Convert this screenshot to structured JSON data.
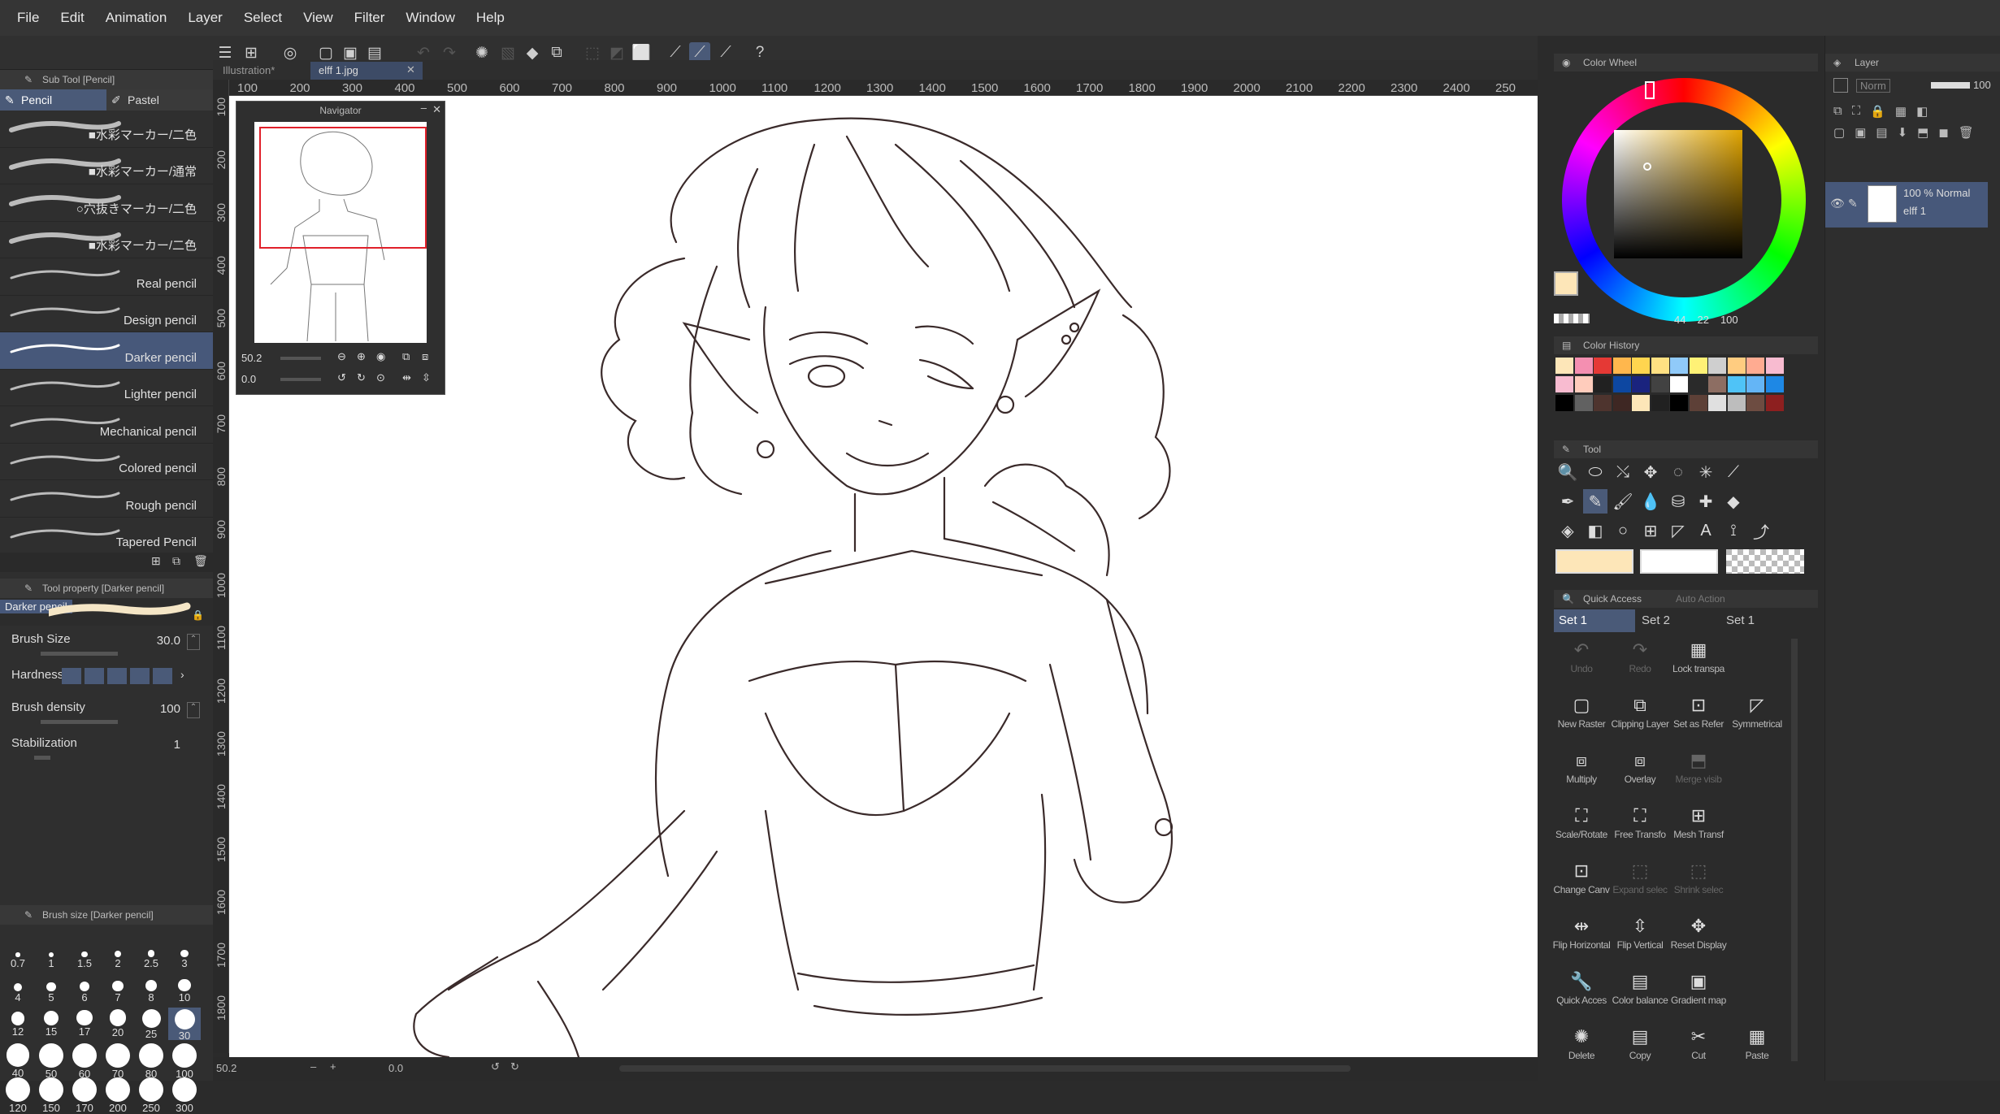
{
  "app": {
    "title_hint": ""
  },
  "menu": [
    "File",
    "Edit",
    "Animation",
    "Layer",
    "Select",
    "View",
    "Filter",
    "Window",
    "Help"
  ],
  "doc_tabs": [
    {
      "label": "Illustration*"
    },
    {
      "label": "elff 1.jpg"
    }
  ],
  "sub_tool": {
    "header": "Sub Tool [Pencil]",
    "tabs": [
      {
        "label": "Pencil",
        "icon": "pencil-icon"
      },
      {
        "label": "Pastel",
        "icon": "pastel-icon"
      }
    ],
    "brushes": [
      {
        "label": "■水彩マーカー/二色"
      },
      {
        "label": "■水彩マーカー/通常"
      },
      {
        "label": "○穴抜きマーカー/二色"
      },
      {
        "label": "■水彩マーカー/二色"
      },
      {
        "label": "Real pencil"
      },
      {
        "label": "Design pencil"
      },
      {
        "label": "Darker pencil",
        "selected": true
      },
      {
        "label": "Lighter pencil"
      },
      {
        "label": "Mechanical pencil"
      },
      {
        "label": "Colored pencil"
      },
      {
        "label": "Rough pencil"
      },
      {
        "label": "Tapered Pencil"
      }
    ]
  },
  "tool_property": {
    "header": "Tool property [Darker pencil]",
    "preview_label": "Darker pencil",
    "brush_size": {
      "label": "Brush Size",
      "value": "30.0"
    },
    "hardness": {
      "label": "Hardness"
    },
    "brush_density": {
      "label": "Brush density",
      "value": "100"
    },
    "stabilization": {
      "label": "Stabilization",
      "value": "1"
    }
  },
  "brush_size_panel": {
    "header": "Brush size [Darker pencil]",
    "sizes": [
      "0.7",
      "1",
      "1.5",
      "2",
      "2.5",
      "3",
      "4",
      "5",
      "6",
      "7",
      "8",
      "10",
      "12",
      "15",
      "17",
      "20",
      "25",
      "30",
      "40",
      "50",
      "60",
      "70",
      "80",
      "100",
      "120",
      "150",
      "170",
      "200",
      "250",
      "300"
    ],
    "selected": "30"
  },
  "ruler": {
    "h_ticks": [
      "100",
      "200",
      "300",
      "400",
      "500",
      "600",
      "700",
      "800",
      "900",
      "1000",
      "1100",
      "1200",
      "1300",
      "1400",
      "1500",
      "1600",
      "1700",
      "1800",
      "1900",
      "2000",
      "2100",
      "2200",
      "2300",
      "2400",
      "250"
    ],
    "v_ticks": [
      "100",
      "200",
      "300",
      "400",
      "500",
      "600",
      "700",
      "800",
      "900",
      "1000",
      "1100",
      "1200",
      "1300",
      "1400",
      "1500",
      "1600",
      "1700",
      "1800"
    ]
  },
  "navigator": {
    "title": "Navigator",
    "zoom": "50.2",
    "rotation": "0.0"
  },
  "status": {
    "zoom": "50.2",
    "rotation": "0.0"
  },
  "color_wheel": {
    "header": "Color Wheel",
    "readout": [
      "44",
      "22",
      "100"
    ],
    "main_color": "#fde6b8",
    "sub_color": "#ffffff"
  },
  "color_history": {
    "header": "Color History",
    "rows": [
      [
        "#fde6b8",
        "#f48fb1",
        "#e53935",
        "#ffb74d",
        "#ffd54f",
        "#ffe082",
        "#90caf9",
        "#fff176",
        "#cfcfcf",
        "#ffcc80",
        "#ffab91",
        "#f8bbd0"
      ],
      [
        "#f8bbd0",
        "#ffccbc",
        "#212121",
        "#0d47a1",
        "#1a237e",
        "#424242",
        "#ffffff",
        "#2a2a2a",
        "#8d6e63",
        "#4fc3f7",
        "#64b5f6",
        "#1e88e5"
      ],
      [
        "#000000",
        "#616161",
        "#4e342e",
        "#3e2723",
        "#fde6b8",
        "#212121",
        "#000000",
        "#5d4037",
        "#e0e0e0",
        "#bdbdbd",
        "#6d4c41",
        "#8d1f1f"
      ]
    ]
  },
  "tool_panel": {
    "header": "Tool"
  },
  "quick_access": {
    "header": "Quick Access",
    "header2": "Auto Action",
    "sets": [
      "Set 1",
      "Set 2",
      "Set 1"
    ],
    "buttons": [
      {
        "label": "Undo",
        "icon": "undo-icon",
        "dim": true
      },
      {
        "label": "Redo",
        "icon": "redo-icon",
        "dim": true
      },
      {
        "label": "Lock transpa",
        "icon": "lock-transparency-icon"
      },
      {
        "label": "New Raster",
        "icon": "new-raster-icon"
      },
      {
        "label": "Clipping Layer",
        "icon": "clipping-layer-icon"
      },
      {
        "label": "Set as Refer",
        "icon": "reference-icon"
      },
      {
        "label": "Symmetrical",
        "icon": "symmetrical-ruler-icon"
      },
      {
        "label": "Multiply",
        "icon": "multiply-icon"
      },
      {
        "label": "Overlay",
        "icon": "overlay-icon"
      },
      {
        "label": "Merge visib",
        "icon": "merge-visible-icon",
        "dim": true
      },
      {
        "label": "Scale/Rotate",
        "icon": "scale-rotate-icon"
      },
      {
        "label": "Free Transfo",
        "icon": "free-transform-icon"
      },
      {
        "label": "Mesh Transf",
        "icon": "mesh-transform-icon"
      },
      {
        "label": "Change Canv",
        "icon": "change-canvas-icon"
      },
      {
        "label": "Expand selec",
        "icon": "expand-selection-icon",
        "dim": true
      },
      {
        "label": "Shrink selec",
        "icon": "shrink-selection-icon",
        "dim": true
      },
      {
        "label": "Flip Horizontal",
        "icon": "flip-horizontal-icon"
      },
      {
        "label": "Flip Vertical",
        "icon": "flip-vertical-icon"
      },
      {
        "label": "Reset Display",
        "icon": "reset-display-icon"
      },
      {
        "label": "Quick Acces",
        "icon": "quick-access-icon"
      },
      {
        "label": "Color balance",
        "icon": "color-balance-icon"
      },
      {
        "label": "Gradient map",
        "icon": "gradient-map-icon"
      },
      {
        "label": "Delete",
        "icon": "delete-icon"
      },
      {
        "label": "Copy",
        "icon": "copy-icon"
      },
      {
        "label": "Cut",
        "icon": "cut-icon"
      },
      {
        "label": "Paste",
        "icon": "paste-icon"
      }
    ]
  },
  "layer": {
    "header": "Layer",
    "blend_mode": "Norm",
    "opacity": "100",
    "layers": [
      {
        "meta": "100 % Normal",
        "name": "elff 1"
      }
    ]
  },
  "colors": {
    "accent": "#4a5a78",
    "selection": "#47587a"
  }
}
